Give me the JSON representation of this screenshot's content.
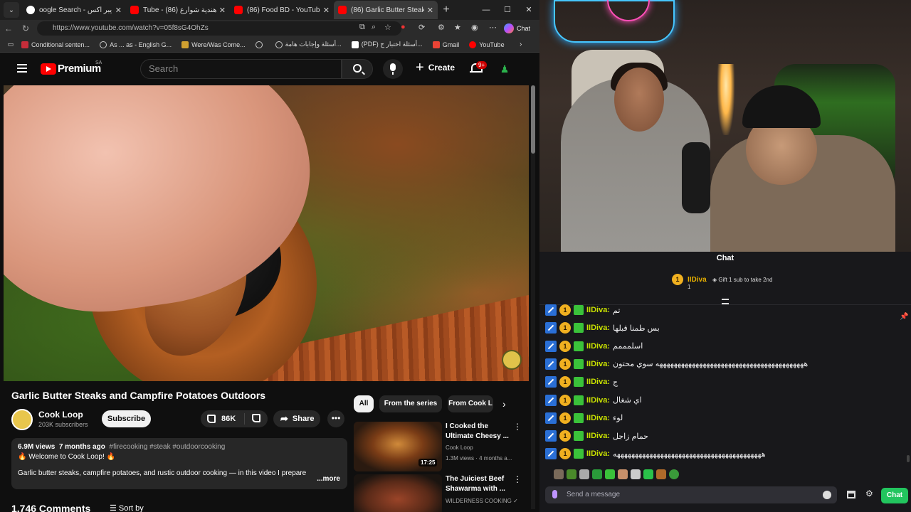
{
  "browser": {
    "tabs": [
      {
        "title": "oogle Search - مايك هايبر اكس",
        "favicon": "google",
        "active": false
      },
      {
        "title": "Tube - مطاعم هندية شوارع (86)",
        "favicon": "youtube",
        "active": false
      },
      {
        "title": "(86) Food BD - YouTube",
        "favicon": "youtube",
        "active": false
      },
      {
        "title": "(86) Garlic Butter Steaks a",
        "favicon": "youtube",
        "active": true
      }
    ],
    "url": "https://www.youtube.com/watch?v=05f8sG4OhZs",
    "chat_label": "Chat",
    "bookmarks": [
      {
        "label": "Conditional senten...",
        "icon": "flag-uk-icon"
      },
      {
        "label": "As ... as - English G...",
        "icon": "globe-icon"
      },
      {
        "label": "Were/Was Come...",
        "icon": "bookmark-icon"
      },
      {
        "label": "",
        "icon": "globe-icon"
      },
      {
        "label": "أسئلة وإجابات هامة...",
        "icon": "globe-icon"
      },
      {
        "label": "(PDF) أسئلة اختبار ج...",
        "icon": "pdf-icon"
      },
      {
        "label": "Gmail",
        "icon": "gmail-icon"
      },
      {
        "label": "YouTube",
        "icon": "youtube-icon"
      }
    ]
  },
  "youtube": {
    "logo_text": "Premium",
    "region": "SA",
    "search_placeholder": "Search",
    "create_label": "Create",
    "notif_count": "9+",
    "video": {
      "title": "Garlic Butter Steaks and Campfire Potatoes Outdoors",
      "channel": "Cook Loop",
      "subscribers": "203K subscribers",
      "subscribe_label": "Subscribe",
      "likes": "86K",
      "share_label": "Share",
      "views": "6.9M views",
      "age": "7 months ago",
      "tags": "#firecooking #steak #outdoorcooking",
      "welcome": "🔥 Welcome to Cook Loop! 🔥",
      "description": "Garlic butter steaks, campfire potatoes, and rustic outdoor cooking — in this video I prepare",
      "more_label": "...more",
      "comments": "1,746 Comments",
      "sort_label": "Sort by"
    },
    "chips": [
      "All",
      "From the series",
      "From Cook L"
    ],
    "recommendations": [
      {
        "title": "I Cooked the Ultimate Cheesy ...",
        "channel": "Cook Loop",
        "meta": "1.3M views · 4 months a...",
        "duration": "17:25"
      },
      {
        "title": "The Juiciest Beef Shawarma with ...",
        "channel": "WILDERNESS COOKING ✓",
        "meta": "",
        "duration": ""
      }
    ]
  },
  "stream": {
    "chat_title": "Chat",
    "hype": {
      "name": "IIDiva",
      "level": "1",
      "count": "1",
      "gift_text": "Gift 1 sub to take 2nd"
    },
    "messages": [
      {
        "user": "IIDiva:",
        "text": "تم"
      },
      {
        "user": "IIDiva:",
        "text": "بس طمنا قبلها"
      },
      {
        "user": "IIDiva:",
        "text": "اسلمممم"
      },
      {
        "user": "IIDiva:",
        "text": "هههههههههههههههههههههههههههههههههههههههههه سوي محتون"
      },
      {
        "user": "IIDiva:",
        "text": "ج"
      },
      {
        "user": "IIDiva:",
        "text": "اي شغال"
      },
      {
        "user": "IIDiva:",
        "text": "لوء"
      },
      {
        "user": "IIDiva:",
        "text": "حمام زاجل"
      },
      {
        "user": "IIDiva:",
        "text": "هههههههههههههههههههههههههههههههههههههههههه"
      }
    ],
    "input_placeholder": "Send a message",
    "send_label": "Chat"
  }
}
